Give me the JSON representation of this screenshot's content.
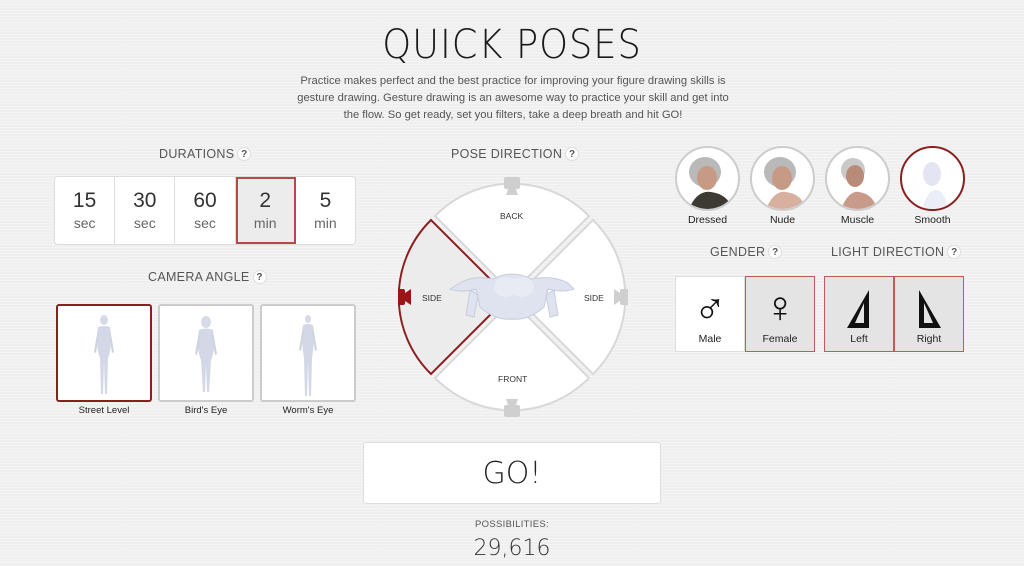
{
  "header": {
    "title": "QUICK POSES",
    "intro": "Practice makes perfect and the best practice for improving your figure drawing skills is gesture drawing. Gesture drawing is an awesome way to practice your skill and get into the flow. So get ready, set you filters, take a deep breath and hit GO!"
  },
  "help_icon": "?",
  "durations": {
    "label": "DURATIONS",
    "selected": "2 min",
    "items": [
      {
        "value": "15",
        "unit": "sec"
      },
      {
        "value": "30",
        "unit": "sec"
      },
      {
        "value": "60",
        "unit": "sec"
      },
      {
        "value": "2",
        "unit": "min"
      },
      {
        "value": "5",
        "unit": "min"
      }
    ]
  },
  "camera_angle": {
    "label": "CAMERA ANGLE",
    "selected": "Street Level",
    "items": [
      {
        "label": "Street Level"
      },
      {
        "label": "Bird's Eye"
      },
      {
        "label": "Worm's Eye"
      }
    ]
  },
  "pose_direction": {
    "label": "POSE DIRECTION",
    "selected": "SIDE (left)",
    "segments": {
      "back": "BACK",
      "front": "FRONT",
      "left": "SIDE",
      "right": "SIDE"
    }
  },
  "models": {
    "selected": "Smooth",
    "items": [
      {
        "label": "Dressed"
      },
      {
        "label": "Nude"
      },
      {
        "label": "Muscle"
      },
      {
        "label": "Smooth"
      }
    ]
  },
  "gender": {
    "label": "GENDER",
    "selected": "Female",
    "items": [
      {
        "label": "Male",
        "symbol": "♂"
      },
      {
        "label": "Female",
        "symbol": "♀"
      }
    ]
  },
  "light_direction": {
    "label": "LIGHT DIRECTION",
    "selected": [
      "Left",
      "Right"
    ],
    "items": [
      {
        "label": "Left"
      },
      {
        "label": "Right"
      }
    ]
  },
  "go_button": "GO!",
  "possibilities": {
    "label": "POSSIBILITIES:",
    "value": "29,616"
  },
  "colors": {
    "accent": "#8a1f1f",
    "selected_bg": "#e4e4e4",
    "background": "#efefef"
  }
}
